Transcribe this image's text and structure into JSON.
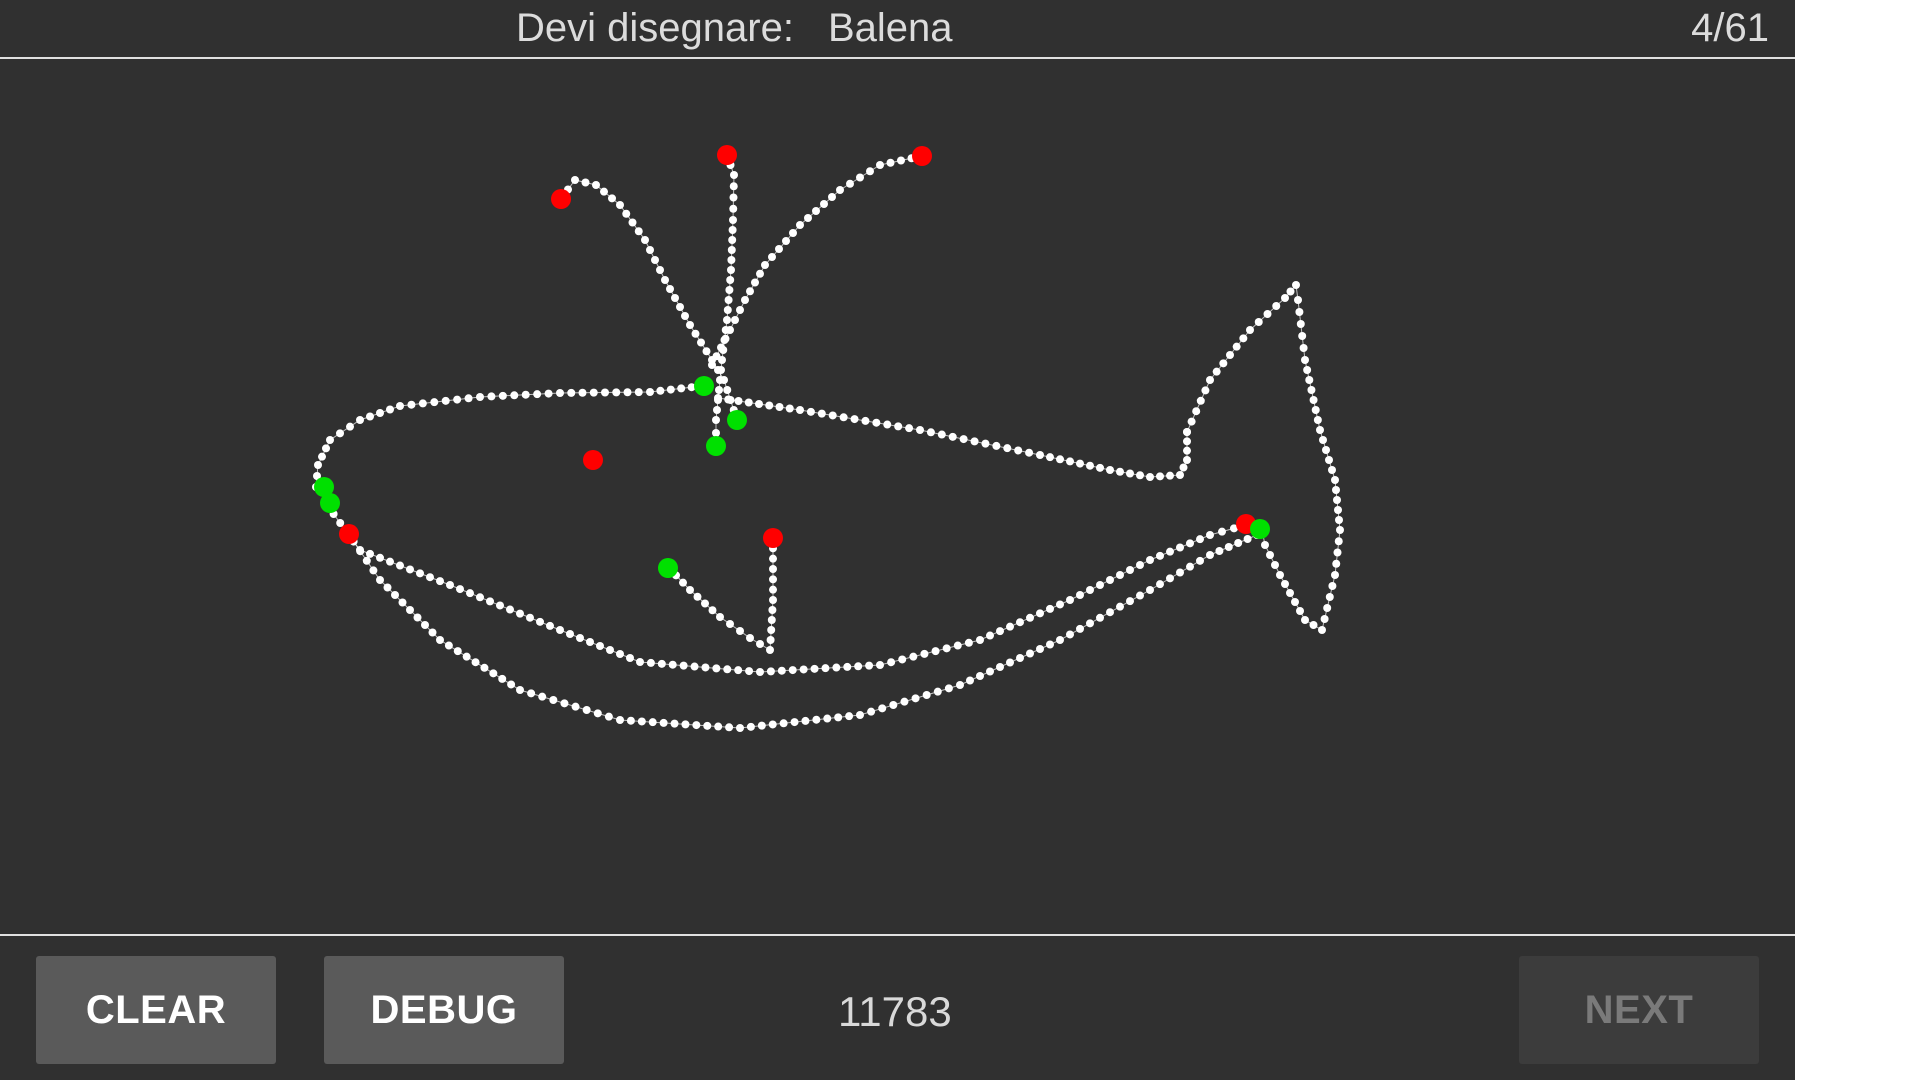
{
  "header": {
    "prompt_label": "Devi disegnare:",
    "target_word": "Balena",
    "progress": "4/61"
  },
  "footer": {
    "clear_label": "CLEAR",
    "debug_label": "DEBUG",
    "score": "11783",
    "next_label": "NEXT"
  },
  "colors": {
    "background": "#303030",
    "stroke": "#ffffff",
    "stroke_start": "#00e000",
    "stroke_end": "#ff0000"
  }
}
